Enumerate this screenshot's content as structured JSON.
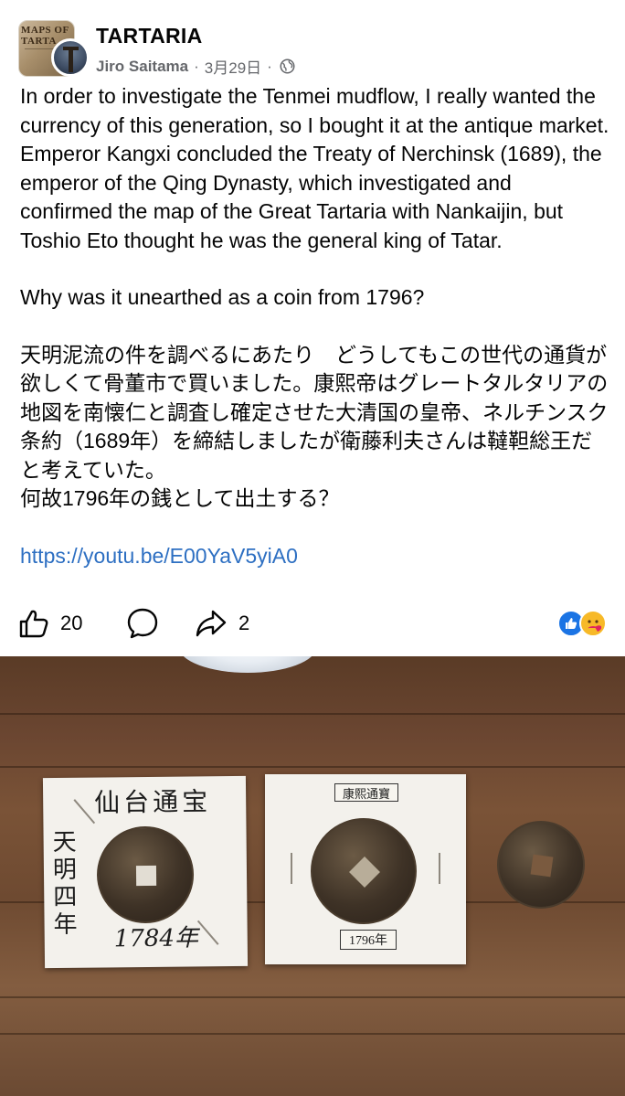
{
  "group": {
    "name": "TARTARIA",
    "avatar_text": "MAPS OF TARTA"
  },
  "meta": {
    "author": "Jiro Saitama",
    "separator": "·",
    "date": "3月29日",
    "separator2": "·"
  },
  "post": {
    "paragraph_en_1": "In order to investigate the Tenmei mudflow, I really wanted the currency of this generation, so I bought it at the antique market. Emperor Kangxi concluded the Treaty of Nerchinsk (1689), the emperor of the Qing Dynasty, which investigated and confirmed the map of the Great Tartaria with Nankaijin, but Toshio Eto thought he was the general king of Tatar.",
    "paragraph_en_2": "Why was it unearthed as a coin from 1796?",
    "paragraph_jp_1": "天明泥流の件を調べるにあたり　どうしてもこの世代の通貨が欲しくて骨董市で買いました。康熙帝はグレートタルタリアの地図を南懐仁と調査し確定させた大清国の皇帝、ネルチンスク条約（1689年）を締結しましたが衛藤利夫さんは韃靼総王だと考えていた。",
    "paragraph_jp_2": "何故1796年の銭として出土する？",
    "link": "https://youtu.be/E00YaV5yiA0"
  },
  "actions": {
    "like_count": "20",
    "share_count": "2"
  },
  "photo": {
    "left_card_title": "仙台通宝",
    "left_card_vertical": "天明四年",
    "left_card_year": "1784年",
    "mid_card_top_label": "康熙通寶",
    "mid_card_bottom_label": "1796年"
  },
  "colors": {
    "link": "#2d6fc2",
    "meta": "#65676b",
    "like_reaction": "#1b74e4",
    "care_reaction": "#f7b928"
  }
}
